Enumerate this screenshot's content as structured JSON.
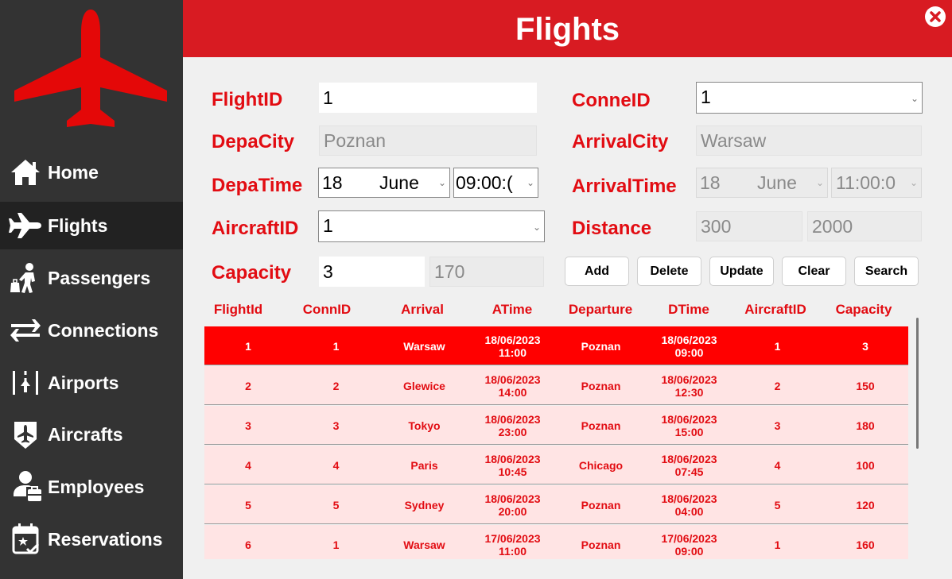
{
  "header": {
    "title": "Flights"
  },
  "sidebar": {
    "items": [
      {
        "label": "Home",
        "icon": "home-icon"
      },
      {
        "label": "Flights",
        "icon": "airplane-icon",
        "active": true
      },
      {
        "label": "Passengers",
        "icon": "passenger-luggage-icon"
      },
      {
        "label": "Connections",
        "icon": "swap-arrows-icon"
      },
      {
        "label": "Airports",
        "icon": "airport-icon"
      },
      {
        "label": "Aircrafts",
        "icon": "aircraft-shield-icon"
      },
      {
        "label": "Employees",
        "icon": "employee-icon"
      },
      {
        "label": "Reservations",
        "icon": "calendar-star-icon"
      }
    ]
  },
  "form": {
    "flight_id": {
      "label": "FlightID",
      "value": "1"
    },
    "conn_id": {
      "label": "ConneID",
      "value": "1"
    },
    "depa_city": {
      "label": "DepaCity",
      "value": "Poznan"
    },
    "arrival_city": {
      "label": "ArrivalCity",
      "value": "Warsaw"
    },
    "depa_time": {
      "label": "DepaTime",
      "day": "18",
      "month": "June",
      "time": "09:00:("
    },
    "arrival_time": {
      "label": "ArrivalTime",
      "day": "18",
      "month": "June",
      "time": "11:00:0"
    },
    "aircraft_id": {
      "label": "AircraftID",
      "value": "1"
    },
    "distance": {
      "label": "Distance",
      "value1": "300",
      "value2": "2000"
    },
    "capacity": {
      "label": "Capacity",
      "value": "3",
      "max": "170"
    }
  },
  "buttons": {
    "add": "Add",
    "delete": "Delete",
    "update": "Update",
    "clear": "Clear",
    "search": "Search"
  },
  "table": {
    "columns": [
      "FlightId",
      "ConnID",
      "Arrival",
      "ATime",
      "Departure",
      "DTime",
      "AircraftID",
      "Capacity"
    ],
    "rows": [
      {
        "flight_id": "1",
        "conn_id": "1",
        "arrival": "Warsaw",
        "atime_date": "18/06/2023",
        "atime_time": "11:00",
        "departure": "Poznan",
        "dtime_date": "18/06/2023",
        "dtime_time": "09:00",
        "aircraft_id": "1",
        "capacity": "3"
      },
      {
        "flight_id": "2",
        "conn_id": "2",
        "arrival": "Glewice",
        "atime_date": "18/06/2023",
        "atime_time": "14:00",
        "departure": "Poznan",
        "dtime_date": "18/06/2023",
        "dtime_time": "12:30",
        "aircraft_id": "2",
        "capacity": "150"
      },
      {
        "flight_id": "3",
        "conn_id": "3",
        "arrival": "Tokyo",
        "atime_date": "18/06/2023",
        "atime_time": "23:00",
        "departure": "Poznan",
        "dtime_date": "18/06/2023",
        "dtime_time": "15:00",
        "aircraft_id": "3",
        "capacity": "180"
      },
      {
        "flight_id": "4",
        "conn_id": "4",
        "arrival": "Paris",
        "atime_date": "18/06/2023",
        "atime_time": "10:45",
        "departure": "Chicago",
        "dtime_date": "18/06/2023",
        "dtime_time": "07:45",
        "aircraft_id": "4",
        "capacity": "100"
      },
      {
        "flight_id": "5",
        "conn_id": "5",
        "arrival": "Sydney",
        "atime_date": "18/06/2023",
        "atime_time": "20:00",
        "departure": "Poznan",
        "dtime_date": "18/06/2023",
        "dtime_time": "04:00",
        "aircraft_id": "5",
        "capacity": "120"
      },
      {
        "flight_id": "6",
        "conn_id": "1",
        "arrival": "Warsaw",
        "atime_date": "17/06/2023",
        "atime_time": "11:00",
        "departure": "Poznan",
        "dtime_date": "17/06/2023",
        "dtime_time": "09:00",
        "aircraft_id": "1",
        "capacity": "160"
      }
    ]
  },
  "colors": {
    "brand_red": "#d81b22",
    "label_red": "#e20c12",
    "sidebar": "#333333",
    "row_pink": "#ffe4e4",
    "row_selected": "#ff0000"
  }
}
